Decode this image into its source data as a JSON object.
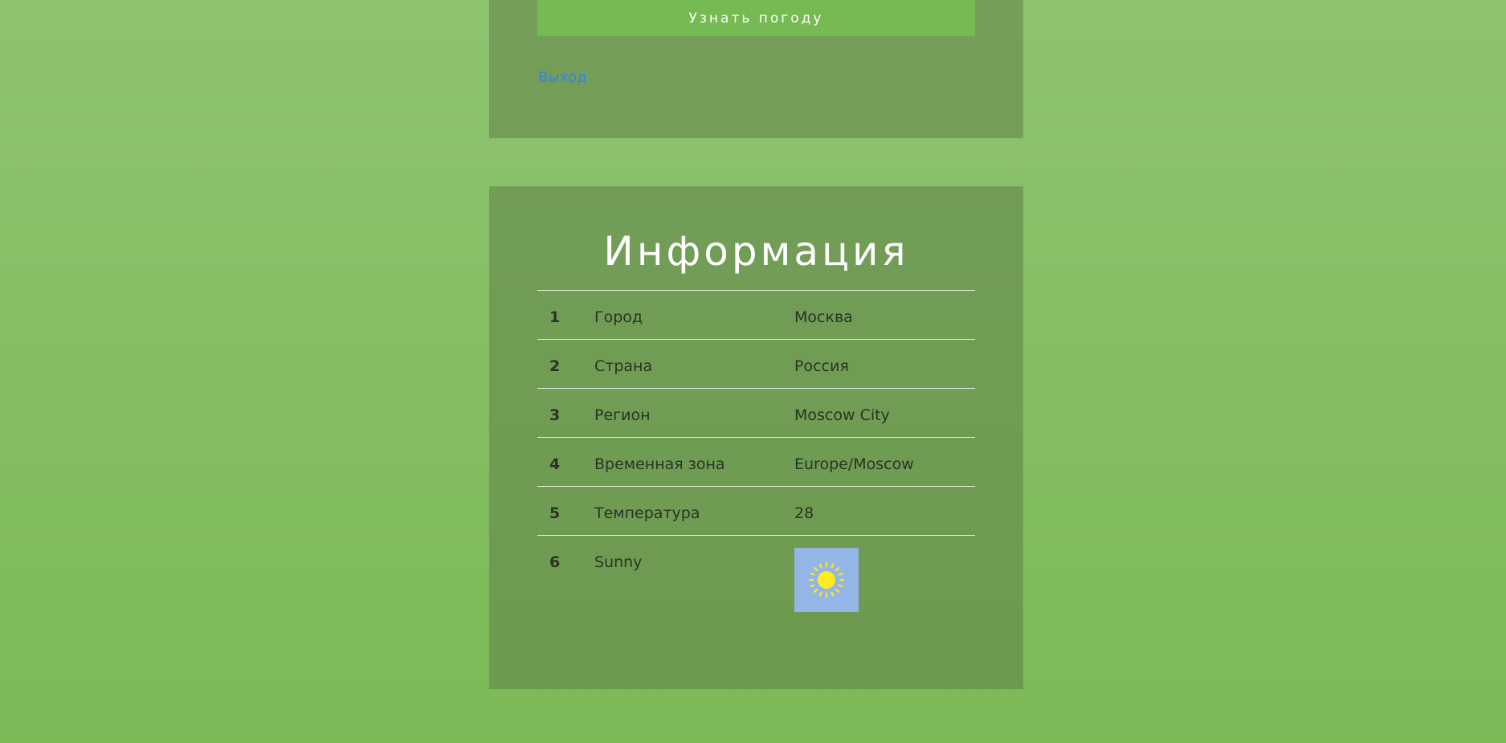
{
  "form": {
    "submit_label": "Узнать погоду",
    "logout_label": "Выход"
  },
  "info": {
    "title": "Информация",
    "rows": [
      {
        "num": "1",
        "key": "Город",
        "value": "Москва"
      },
      {
        "num": "2",
        "key": "Страна",
        "value": "Россия"
      },
      {
        "num": "3",
        "key": "Регион",
        "value": "Moscow City"
      },
      {
        "num": "4",
        "key": "Временная зона",
        "value": "Europe/Moscow"
      },
      {
        "num": "5",
        "key": "Температура",
        "value": "28"
      },
      {
        "num": "6",
        "key": "Sunny",
        "icon": "sun-icon"
      }
    ]
  },
  "colors": {
    "background_top": "#8ec36f",
    "background_bottom": "#7aba55",
    "button": "#75ba52",
    "link": "#2f86e6",
    "icon_bg": "#93b6e6",
    "sun": "#ffec1c"
  }
}
